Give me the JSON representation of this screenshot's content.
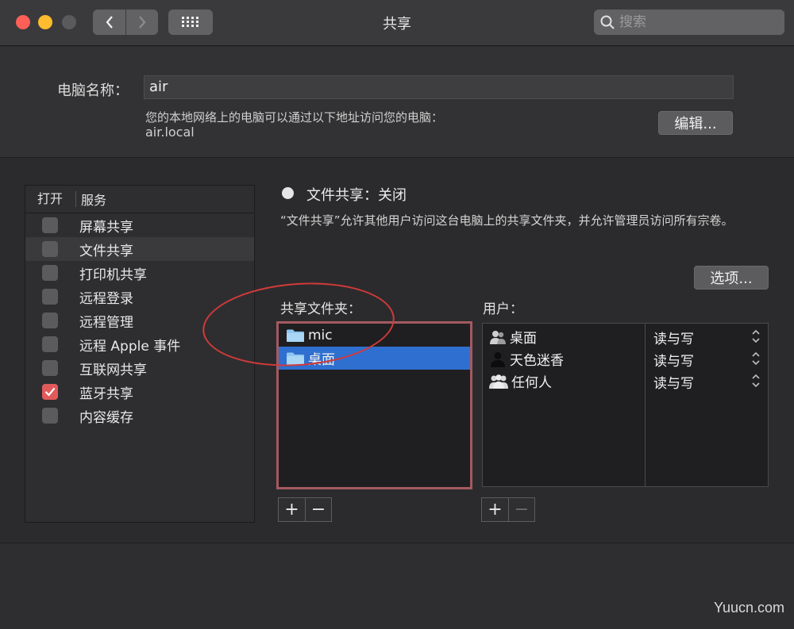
{
  "window": {
    "title": "共享"
  },
  "search": {
    "placeholder": "搜索"
  },
  "computer_name": {
    "label": "电脑名称：",
    "value": "air",
    "description": "您的本地网络上的电脑可以通过以下地址访问您的电脑：",
    "address": "air.local",
    "edit_label": "编辑..."
  },
  "services": {
    "header_on": "打开",
    "header_service": "服务",
    "items": [
      {
        "label": "屏幕共享",
        "checked": false
      },
      {
        "label": "文件共享",
        "checked": false
      },
      {
        "label": "打印机共享",
        "checked": false
      },
      {
        "label": "远程登录",
        "checked": false
      },
      {
        "label": "远程管理",
        "checked": false
      },
      {
        "label": "远程 Apple 事件",
        "checked": false
      },
      {
        "label": "互联网共享",
        "checked": false
      },
      {
        "label": "蓝牙共享",
        "checked": true
      },
      {
        "label": "内容缓存",
        "checked": false
      }
    ]
  },
  "detail": {
    "status": "文件共享：关闭",
    "description": "“文件共享”允许其他用户访问这台电脑上的共享文件夹，并允许管理员访问所有宗卷。",
    "options_label": "选项...",
    "folders_label": "共享文件夹：",
    "users_label": "用户：",
    "folders": [
      {
        "name": "mic"
      },
      {
        "name": "桌面"
      }
    ],
    "users": [
      {
        "name": "桌面",
        "permission": "读与写",
        "icon": "group-user-icon"
      },
      {
        "name": "天色迷香",
        "permission": "读与写",
        "icon": "user-icon"
      },
      {
        "name": "任何人",
        "permission": "读与写",
        "icon": "everyone-icon"
      }
    ],
    "add_label": "+",
    "remove_label": "−"
  },
  "watermark": "Yuucn.com",
  "colors": {
    "accent": "#2f6fcf",
    "checked": "#e15a5a",
    "annotation": "#d23a3a"
  }
}
